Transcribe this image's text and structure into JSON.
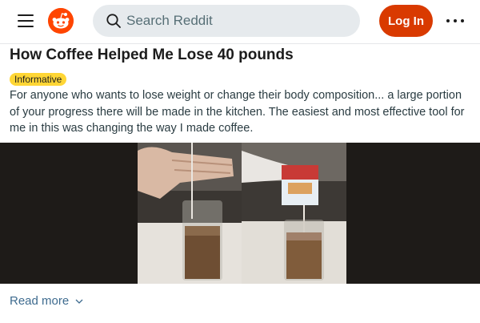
{
  "header": {
    "search_placeholder": "Search Reddit",
    "login_label": "Log In",
    "brand_color": "#ff4500"
  },
  "post": {
    "title": "How Coffee Helped Me Lose 40 pounds",
    "flair": "Informative",
    "body": "For anyone who wants to lose weight or change their body composition... a large portion of your progress there will be made in the kitchen. The easiest and most effective tool for me in this was changing the way I made coffee.",
    "read_more": "Read more"
  },
  "icons": [
    "menu-icon",
    "reddit-logo-icon",
    "search-icon",
    "more-options-icon",
    "chevron-down-icon"
  ]
}
